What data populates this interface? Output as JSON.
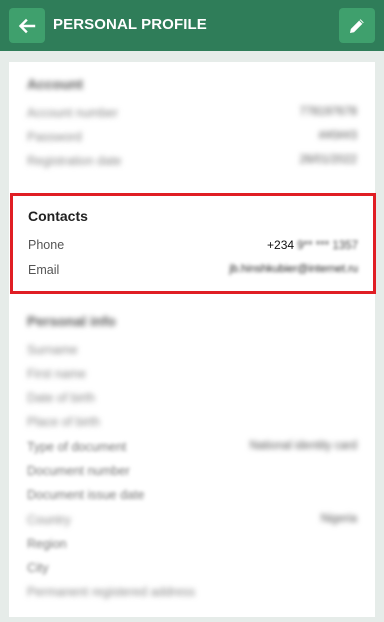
{
  "header": {
    "title": "PERSONAL PROFILE",
    "back_icon": "arrow-left-icon",
    "edit_icon": "pencil-icon",
    "bg_color": "#2f7d59",
    "button_color": "#3fa06d"
  },
  "account": {
    "title": "Account",
    "rows": [
      {
        "label": "Account number",
        "value": "778197678"
      },
      {
        "label": "Password",
        "value": "##0##3"
      },
      {
        "label": "Registration date",
        "value": "26/01/2022"
      }
    ]
  },
  "contacts": {
    "title": "Contacts",
    "phone_label": "Phone",
    "phone_prefix": "+234",
    "phone_rest": "9** *** 1357",
    "email_label": "Email",
    "email_value": "jb.hinshkubier@internet.ru",
    "highlight_color": "#e01e24"
  },
  "personal": {
    "title": "Personal info",
    "rows": [
      {
        "label": "Surname",
        "value": ""
      },
      {
        "label": "First name",
        "value": ""
      },
      {
        "label": "Date of birth",
        "value": ""
      },
      {
        "label": "Place of birth",
        "value": ""
      },
      {
        "label": "Type of document",
        "value": "National identity card"
      },
      {
        "label": "Document number",
        "value": ""
      },
      {
        "label": "Document issue date",
        "value": ""
      },
      {
        "label": "Country",
        "value": "Nigeria"
      },
      {
        "label": "Region",
        "value": ""
      },
      {
        "label": "City",
        "value": ""
      },
      {
        "label": "Permanent registered address",
        "value": ""
      }
    ]
  }
}
